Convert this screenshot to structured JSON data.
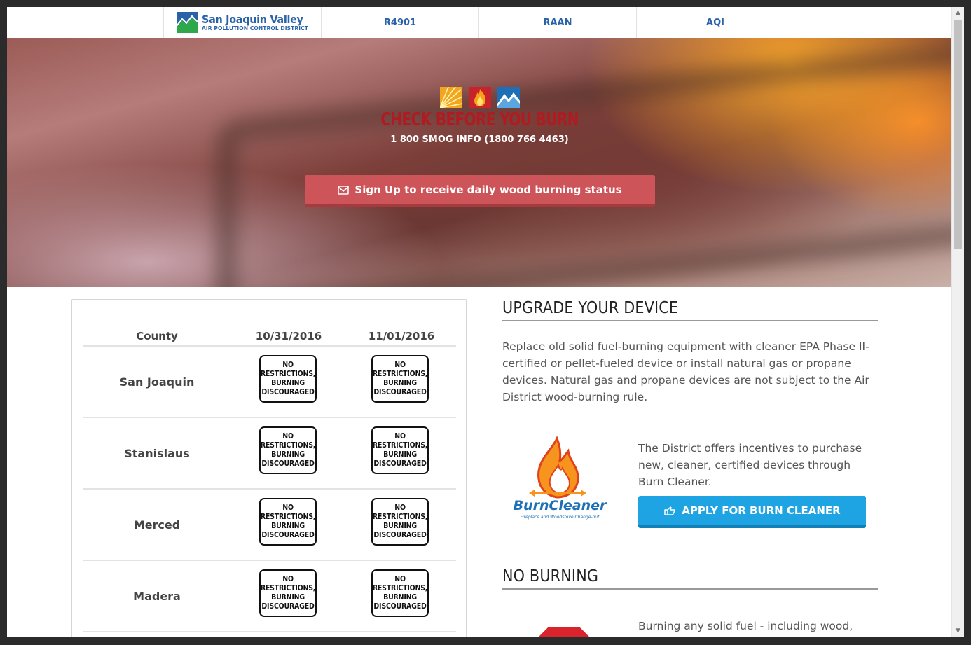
{
  "nav": {
    "logo_line1": "San Joaquin Valley",
    "logo_line2": "AIR POLLUTION CONTROL DISTRICT",
    "links": [
      "R4901",
      "RAAN",
      "AQI"
    ]
  },
  "hero": {
    "title": "CHECK BEFORE YOU BURN",
    "phone": "1 800 SMOG INFO (1800 766 4463)",
    "signup_label": "Sign Up to receive daily wood burning status"
  },
  "forecast": {
    "headers": [
      "County",
      "10/31/2016",
      "11/01/2016"
    ],
    "status_lines": [
      "NO",
      "RESTRICTIONS,",
      "BURNING",
      "DISCOURAGED"
    ],
    "rows": [
      {
        "county": "San Joaquin"
      },
      {
        "county": "Stanislaus"
      },
      {
        "county": "Merced"
      },
      {
        "county": "Madera"
      }
    ]
  },
  "upgrade": {
    "heading": "UPGRADE YOUR DEVICE",
    "body": "Replace old solid fuel-burning equipment with cleaner EPA Phase II-certified or pellet-fueled device or install natural gas or propane devices. Natural gas and propane devices are not subject to the Air District wood-burning rule.",
    "incentive_text": "The District offers incentives to purchase new, cleaner, certified devices through Burn Cleaner.",
    "apply_label": "APPLY FOR BURN CLEANER",
    "logo_text": "BurnCleaner",
    "logo_subtext": "Fireplace and Woodstove Change-out"
  },
  "no_burning": {
    "heading": "NO BURNING",
    "body": "Burning any solid fuel - including wood,"
  },
  "colors": {
    "nav_blue": "#2a62a8",
    "signup_red": "#cd5458",
    "apply_blue": "#1ea3e3",
    "title_red": "#b01b21"
  }
}
